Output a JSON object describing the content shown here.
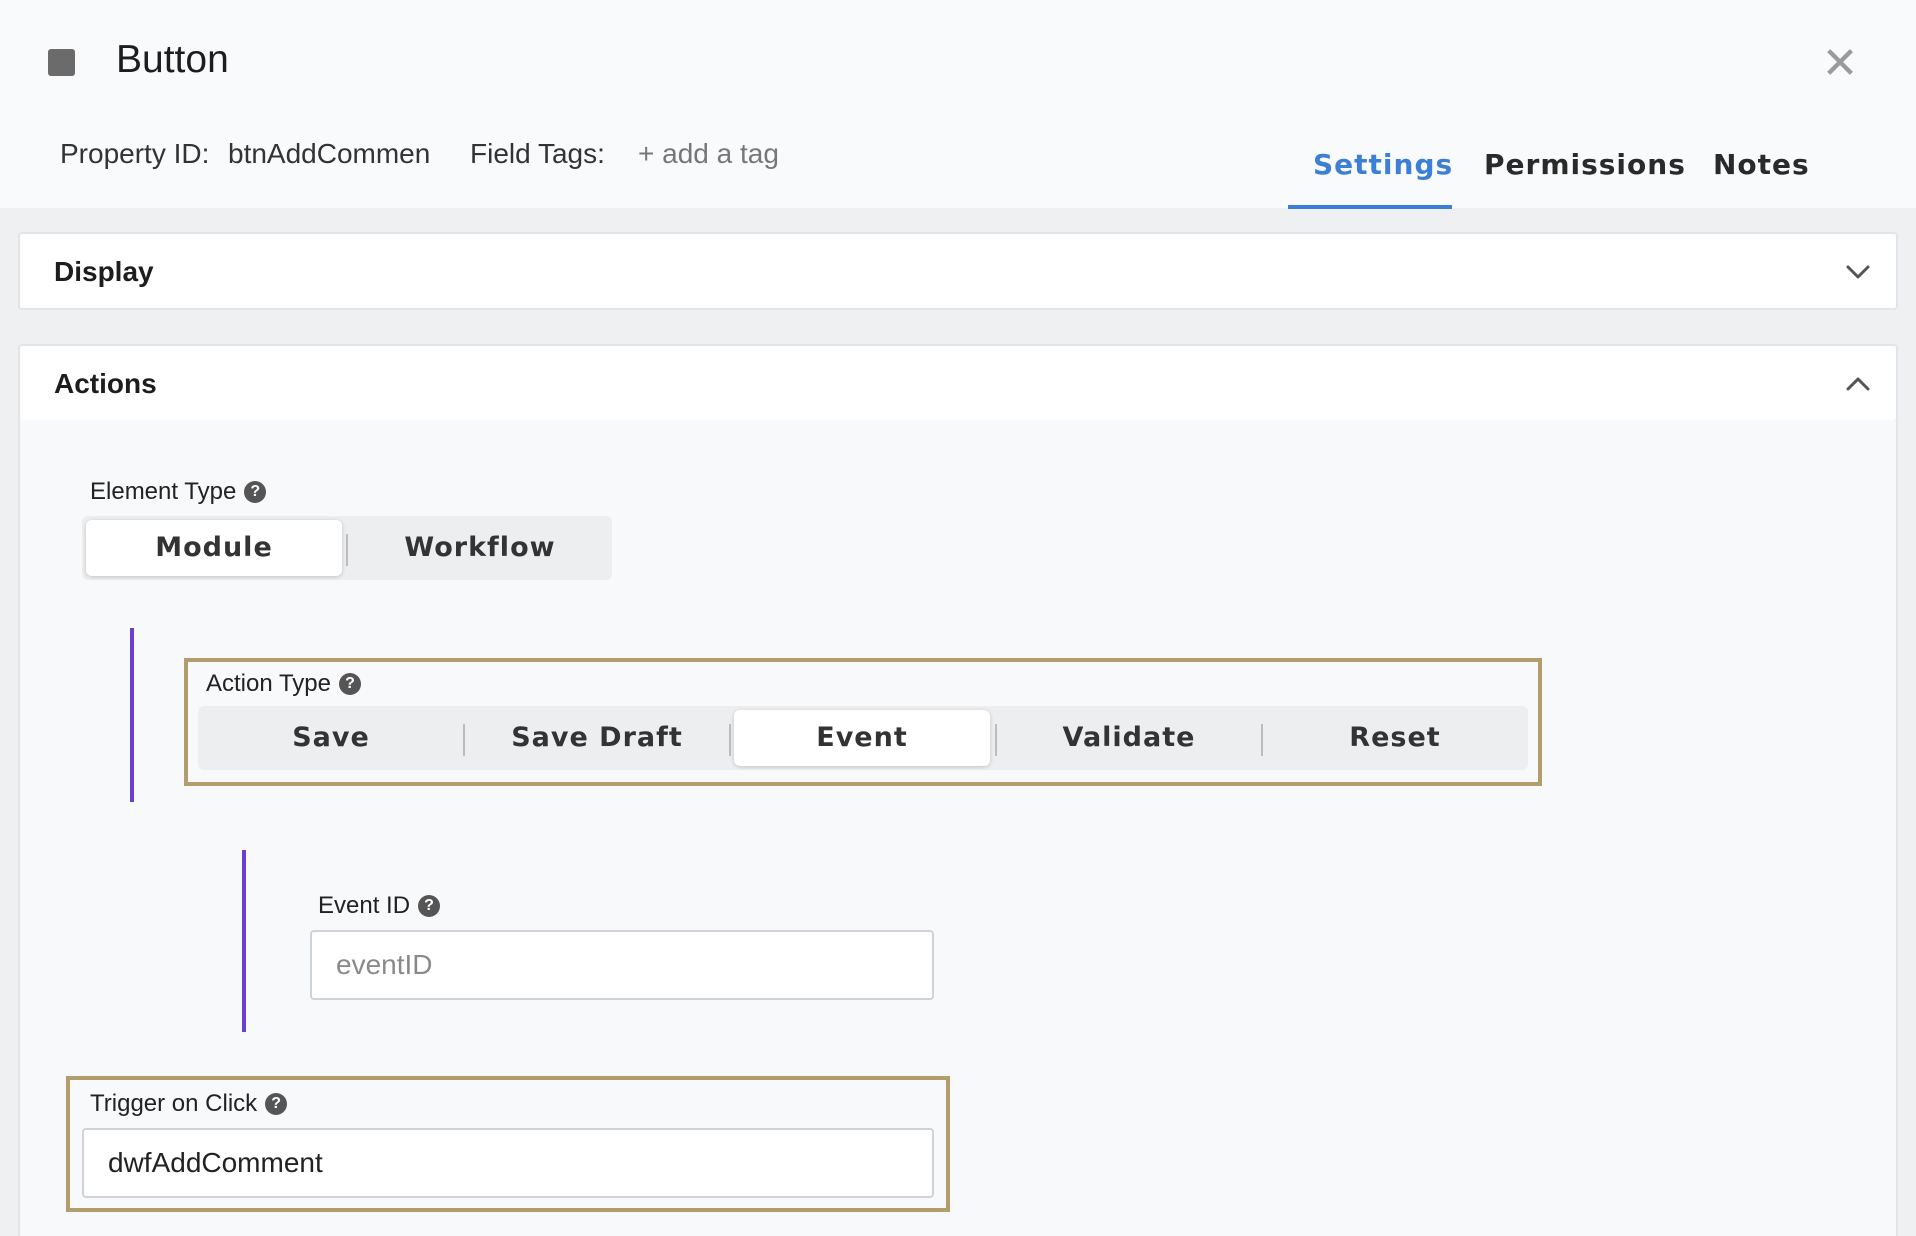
{
  "header": {
    "title": "Button",
    "property_id_label": "Property ID:",
    "property_id_value": "btnAddCommen",
    "field_tags_label": "Field Tags:",
    "add_tag_label": "+ add a tag",
    "close_symbol": "✕"
  },
  "tabs": [
    {
      "label": "Settings",
      "active": true
    },
    {
      "label": "Permissions",
      "active": false
    },
    {
      "label": "Notes",
      "active": false
    }
  ],
  "panels": {
    "display": {
      "title": "Display",
      "expanded": false
    },
    "actions": {
      "title": "Actions",
      "expanded": true
    }
  },
  "element_type": {
    "label": "Element Type",
    "options": [
      "Module",
      "Workflow"
    ],
    "selected": "Module"
  },
  "action_type": {
    "label": "Action Type",
    "options": [
      "Save",
      "Save Draft",
      "Event",
      "Validate",
      "Reset"
    ],
    "selected": "Event"
  },
  "event_id": {
    "label": "Event ID",
    "placeholder": "eventID",
    "value": ""
  },
  "trigger_on_click": {
    "label": "Trigger on Click",
    "value": "dwfAddComment"
  },
  "colors": {
    "accent": "#3c7fd4",
    "nest_bar": "#6a3fd1",
    "highlight_border": "#b19e6c"
  },
  "icons": {
    "title_icon": "button-square-icon",
    "help_icon": "question-circle-icon",
    "close_icon": "close-icon",
    "chevron_down": "chevron-down-icon",
    "chevron_up": "chevron-up-icon"
  }
}
